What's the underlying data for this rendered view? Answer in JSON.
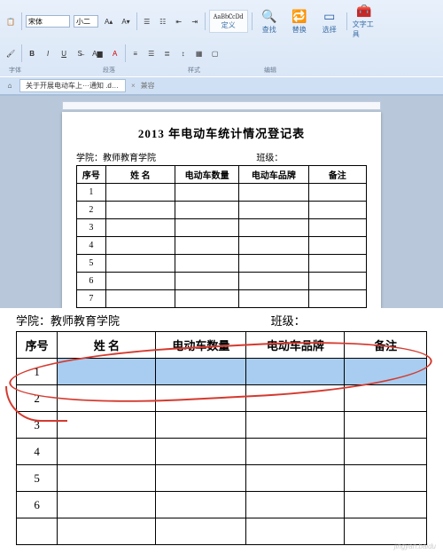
{
  "ribbon": {
    "font_name": "宋体",
    "font_size": "小二",
    "bold": "B",
    "italic": "I",
    "underline": "U",
    "style_sample": "AaBbCcDd",
    "style_caption": "定义",
    "group_font": "字体",
    "group_para": "段落",
    "group_style": "样式",
    "find": "查找",
    "replace": "替换",
    "select": "选择",
    "edit_group": "编辑",
    "tools": "文字工具"
  },
  "tabs": {
    "home_icon": "⌂",
    "doc_tab": "关于开展电动车上···通知 .doc *",
    "close": "×",
    "mode": "兼容"
  },
  "doc": {
    "title": "2013 年电动车统计情况登记表",
    "college_label": "学院：",
    "college_value": "教师教育学院",
    "class_label": "班级：",
    "headers": {
      "idx": "序号",
      "name": "姓   名",
      "qty": "电动车数量",
      "brand": "电动车品牌",
      "note": "备注"
    },
    "rows_upper": [
      "1",
      "2",
      "3",
      "4",
      "5",
      "6",
      "7"
    ],
    "rows_lower": [
      "1",
      "2",
      "3",
      "4",
      "5",
      "6",
      ""
    ]
  },
  "watermark": "jingyan.baidu"
}
